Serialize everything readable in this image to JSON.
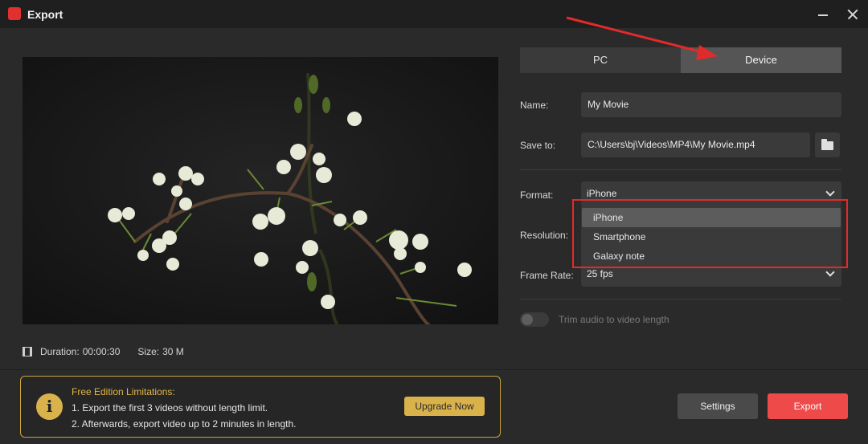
{
  "window": {
    "title": "Export",
    "logo_icon": "app-logo-icon",
    "minimize_icon": "minimize-icon",
    "close_icon": "close-icon"
  },
  "preview": {
    "description_icon": "flower-branch-preview",
    "duration_label": "Duration:",
    "duration_value": "00:00:30",
    "size_label": "Size:",
    "size_value": "30 M"
  },
  "tabs": [
    {
      "label": "PC",
      "active": false
    },
    {
      "label": "Device",
      "active": true
    }
  ],
  "form": {
    "name_label": "Name:",
    "name_value": "My Movie",
    "save_label": "Save to:",
    "save_value": "C:\\Users\\bj\\Videos\\MP4\\My Movie.mp4",
    "format_label": "Format:",
    "format_value": "iPhone",
    "resolution_label": "Resolution:",
    "frame_rate_label": "Frame Rate:",
    "frame_rate_value": "25 fps",
    "trim_audio_label": "Trim audio to video length",
    "trim_audio_on": false
  },
  "format_dropdown": {
    "options": [
      "iPhone",
      "Smartphone",
      "Galaxy note"
    ],
    "selected": "iPhone"
  },
  "notice": {
    "title": "Free Edition Limitations:",
    "line1": "1. Export the first 3 videos without length limit.",
    "line2": "2. Afterwards, export video up to 2 minutes in length.",
    "upgrade_label": "Upgrade Now",
    "info_glyph": "i"
  },
  "footer": {
    "settings_label": "Settings",
    "export_label": "Export"
  },
  "colors": {
    "accent_red": "#ef4a4a",
    "gold": "#d9b24c",
    "annotation_red": "#e32a2a"
  }
}
